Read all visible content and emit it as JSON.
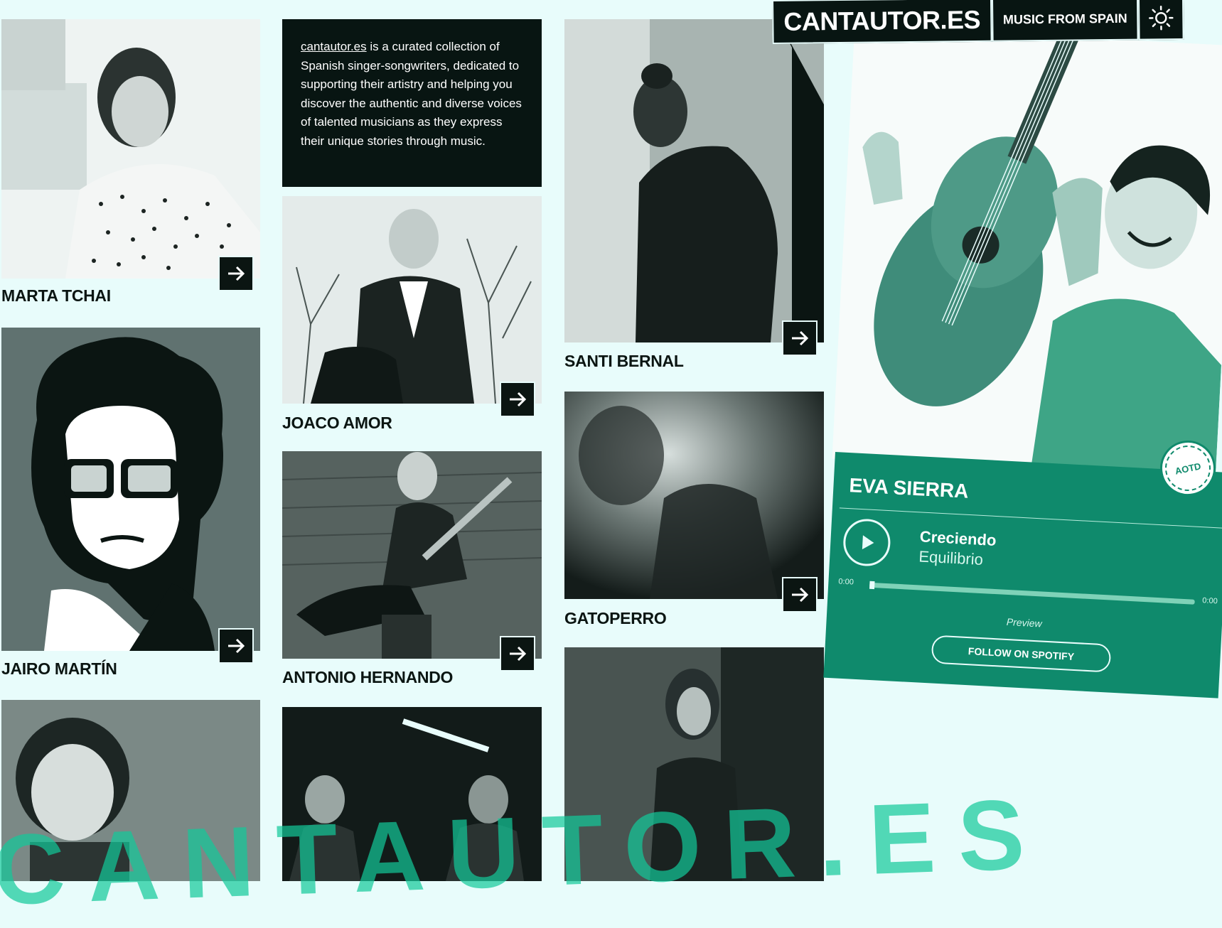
{
  "header": {
    "logo": "CANTAUTOR.ES",
    "tagline": "MUSIC FROM SPAIN",
    "theme_icon": "sun-icon"
  },
  "intro": {
    "link_text": "cantautor.es",
    "text": " is a curated collection of Spanish singer-songwriters, dedicated to supporting their artistry and helping you discover the authentic and diverse voices of talented musicians as they express their unique stories through music."
  },
  "artists": [
    {
      "name": "MARTA TCHAI"
    },
    {
      "name": "JAIRO MARTÍN"
    },
    {
      "name": "JOACO AMOR"
    },
    {
      "name": "ANTONIO HERNANDO"
    },
    {
      "name": "SANTI BERNAL"
    },
    {
      "name": "GATOPERRO"
    }
  ],
  "featured": {
    "artist": "EVA SIERRA",
    "badge": "AOTD",
    "track": "Creciendo",
    "album": "Equilibrio",
    "time_start": "0:00",
    "time_end": "0:00",
    "progress": 0,
    "preview_label": "Preview",
    "follow_label": "FOLLOW ON SPOTIFY"
  },
  "watermark": "CANTAUTOR.ES",
  "colors": {
    "background": "#e8fcfb",
    "dark": "#081512",
    "accent": "#0f8a6c"
  }
}
